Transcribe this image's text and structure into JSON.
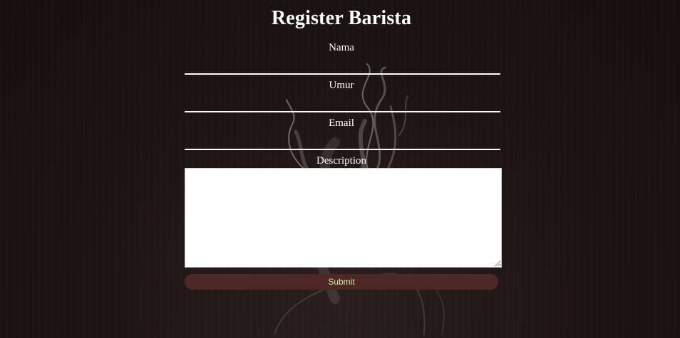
{
  "page": {
    "title": "Register Barista"
  },
  "form": {
    "fields": [
      {
        "label": "Nama",
        "value": ""
      },
      {
        "label": "Umur",
        "value": ""
      },
      {
        "label": "Email",
        "value": ""
      }
    ],
    "description": {
      "label": "Description",
      "value": ""
    },
    "submit_label": "Submit"
  },
  "colors": {
    "background": "#1e1414",
    "text": "#ffffff",
    "submit_background": "#4e2826",
    "submit_text": "#cdeaa0"
  }
}
